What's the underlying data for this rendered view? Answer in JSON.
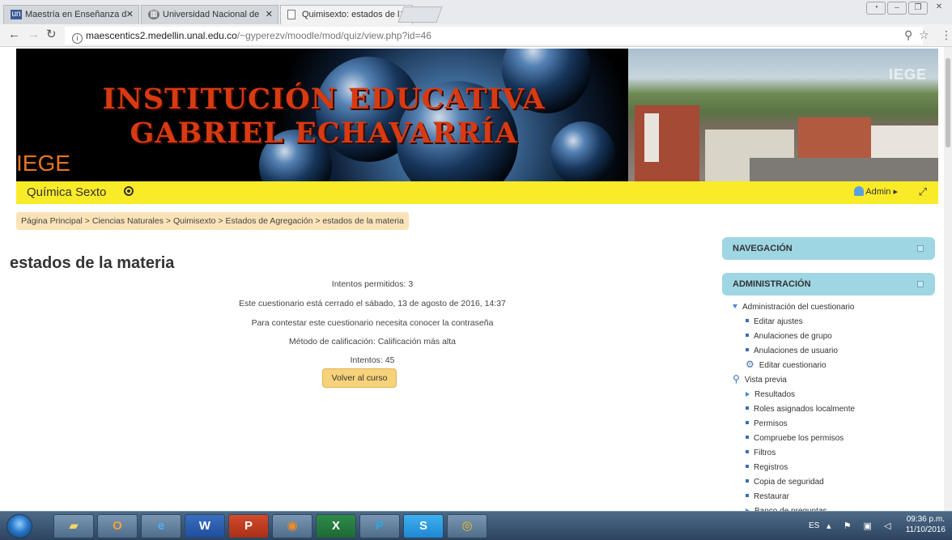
{
  "browser": {
    "tabs": [
      {
        "title": "Maestría en Enseñanza d",
        "icon": "un-icon",
        "active": false
      },
      {
        "title": "Universidad Nacional de",
        "icon": "building-icon",
        "active": false
      },
      {
        "title": "Quimisexto: estados de l",
        "icon": "page-icon",
        "active": true
      }
    ],
    "url_host": "maescentics2.medellin.unal.edu.co",
    "url_path": "/~gyperezv/moodle/mod/quiz/view.php?id=46"
  },
  "banner": {
    "title": "INSTITUCIÓN EDUCATIVA GABRIEL ECHAVARRÍA",
    "logo_text": "IEGE",
    "watermark": "IEGE"
  },
  "header": {
    "course": "Química Sexto",
    "user": "Admin"
  },
  "breadcrumb": [
    "Página Principal",
    "Ciencias Naturales",
    "Quimisexto",
    "Estados de Agregación",
    "estados de la materia"
  ],
  "page": {
    "title": "estados de la materia",
    "info": [
      "Intentos permitidos: 3",
      "Este cuestionario está cerrado el sábado, 13 de agosto de 2016, 14:37",
      "Para contestar este cuestionario necesita conocer la contraseña",
      "Método de calificación: Calificación más alta",
      "Intentos: 45"
    ],
    "back_button": "Volver al curso"
  },
  "blocks": {
    "navigation": "NAVEGACIÓN",
    "administration": "ADMINISTRACIÓN",
    "admin_items": [
      {
        "label": "Administración del cuestionario",
        "type": "expanded",
        "indent": 0
      },
      {
        "label": "Editar ajustes",
        "type": "bullet",
        "indent": 1
      },
      {
        "label": "Anulaciones de grupo",
        "type": "bullet",
        "indent": 1
      },
      {
        "label": "Anulaciones de usuario",
        "type": "bullet",
        "indent": 1
      },
      {
        "label": "Editar cuestionario",
        "type": "gear",
        "indent": 1
      },
      {
        "label": "Vista previa",
        "type": "search",
        "indent": 0
      },
      {
        "label": "Resultados",
        "type": "collapsed",
        "indent": 1
      },
      {
        "label": "Roles asignados localmente",
        "type": "bullet",
        "indent": 1
      },
      {
        "label": "Permisos",
        "type": "bullet",
        "indent": 1
      },
      {
        "label": "Compruebe los permisos",
        "type": "bullet",
        "indent": 1
      },
      {
        "label": "Filtros",
        "type": "bullet",
        "indent": 1
      },
      {
        "label": "Registros",
        "type": "bullet",
        "indent": 1
      },
      {
        "label": "Copia de seguridad",
        "type": "bullet",
        "indent": 1
      },
      {
        "label": "Restaurar",
        "type": "bullet",
        "indent": 1
      },
      {
        "label": "Banco de preguntas",
        "type": "collapsed",
        "indent": 1
      }
    ]
  },
  "taskbar": {
    "apps": [
      "folder-icon",
      "outlook-icon",
      "ie-icon",
      "word-icon",
      "powerpoint-icon",
      "firefox-icon",
      "excel-icon",
      "p-app-icon",
      "skype-icon",
      "chrome-icon"
    ],
    "language": "ES",
    "time": "09:36 p.m.",
    "date": "11/10/2016"
  },
  "colors": {
    "yellow_bar": "#faeb29",
    "block_header": "#9fd6e3",
    "button": "#f7d27a",
    "breadcrumb": "#fbe3b8",
    "banner_title": "#d83a12"
  }
}
